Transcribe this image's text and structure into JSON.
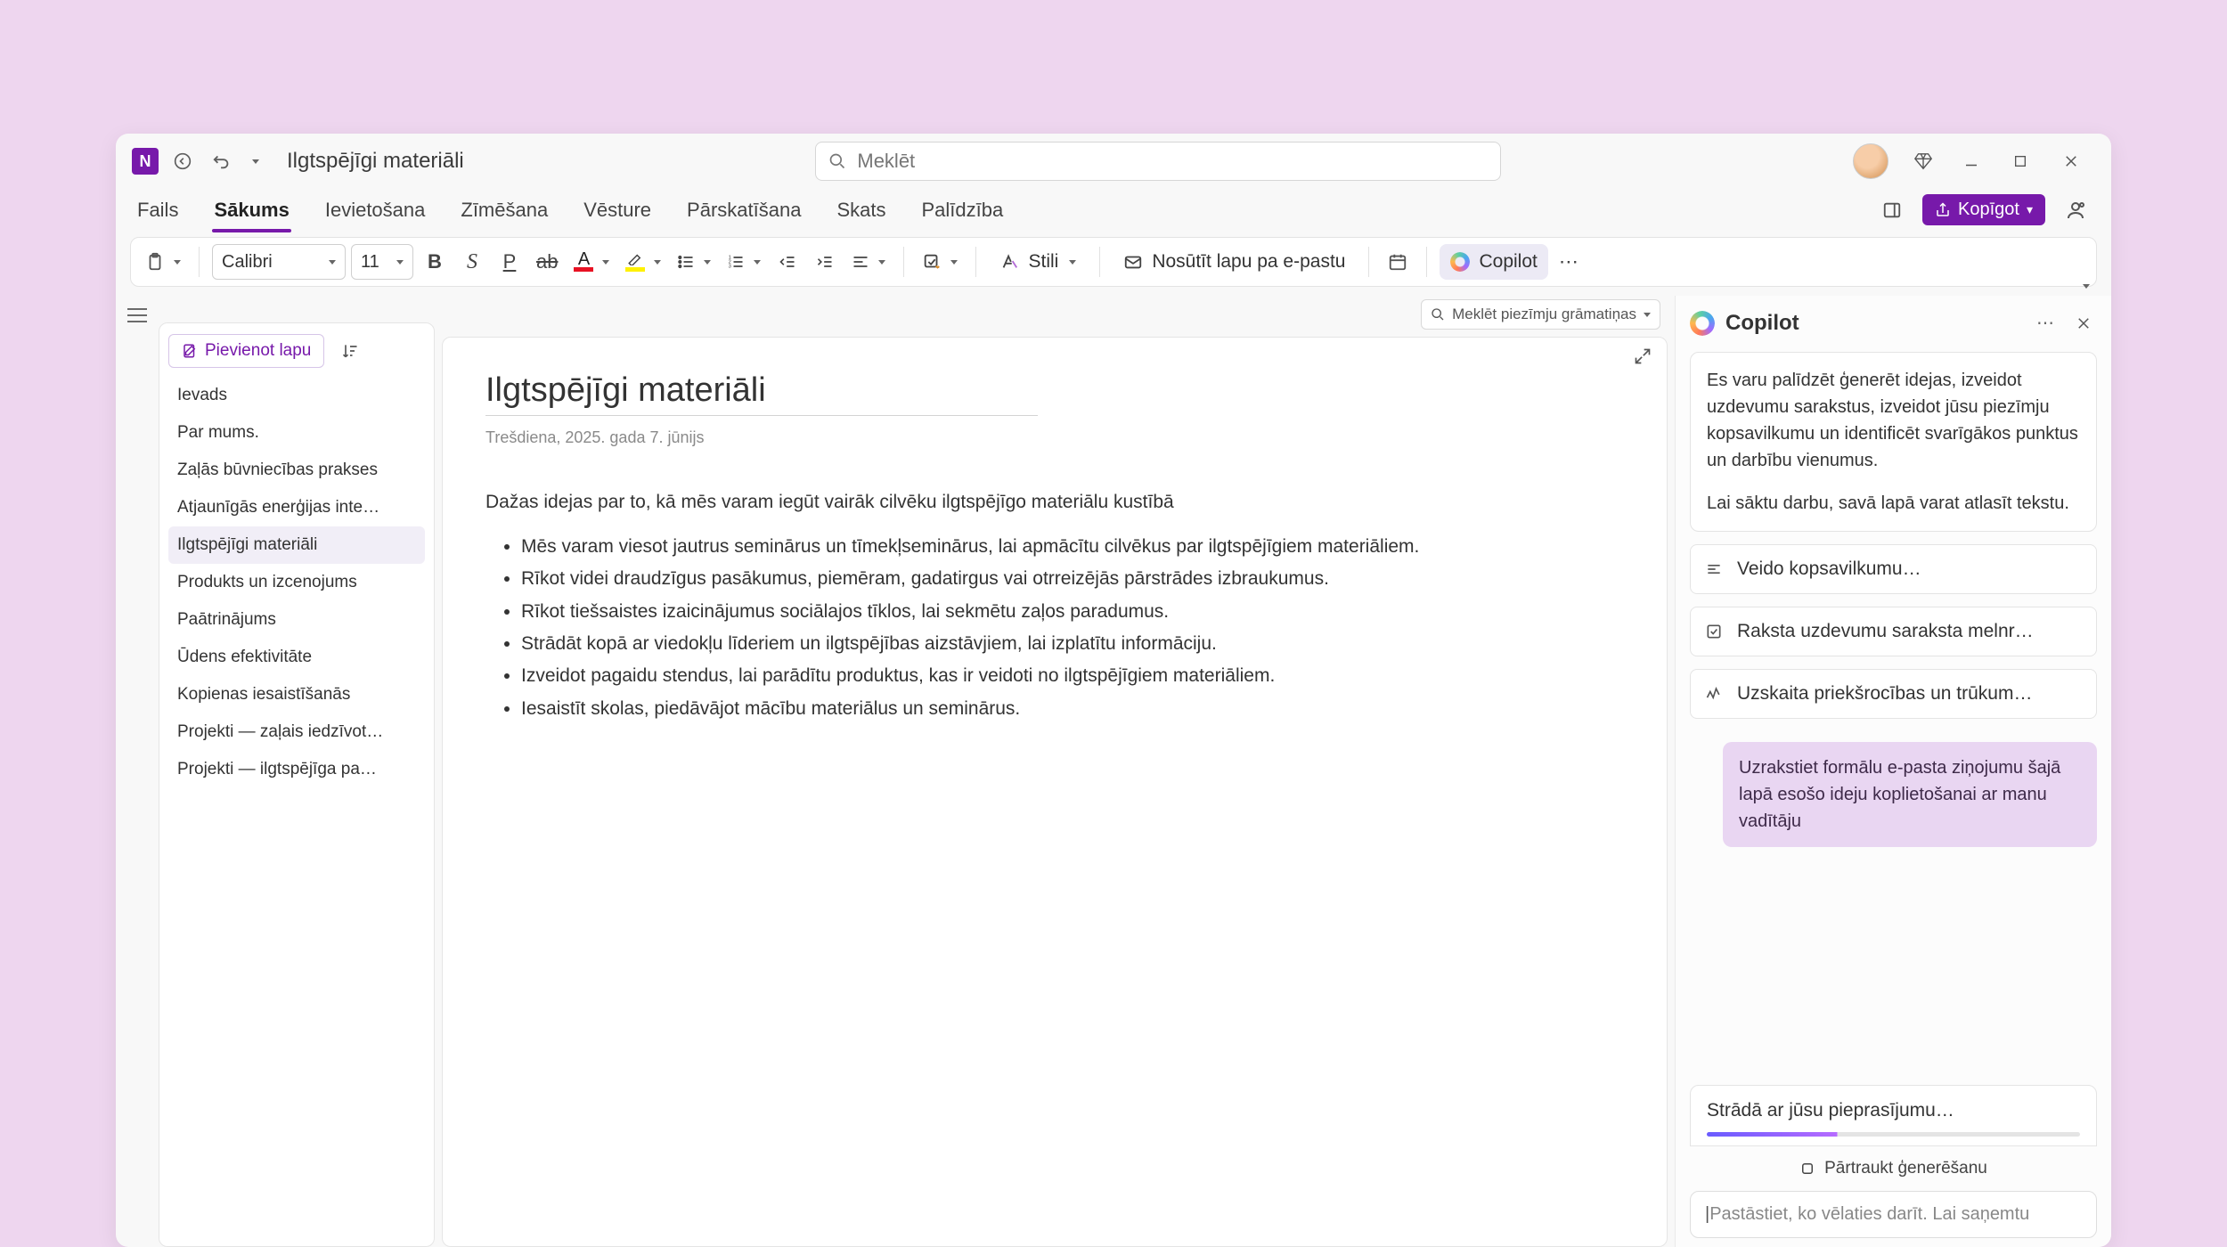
{
  "titlebar": {
    "doc_title": "Ilgtspējīgi materiāli",
    "search_placeholder": "Meklēt"
  },
  "tabs": [
    "Fails",
    "Sākums",
    "Ievietošana",
    "Zīmēšana",
    "Vēsture",
    "Pārskatīšana",
    "Skats",
    "Palīdzība"
  ],
  "active_tab_index": 1,
  "share_label": "Kopīgot",
  "ribbon": {
    "font_name": "Calibri",
    "font_size": "11",
    "styles_label": "Stili",
    "email_label": "Nosūtīt lapu pa e-pastu",
    "copilot_label": "Copilot"
  },
  "notebook_search_label": "Meklēt piezīmju grāmatiņas",
  "sidebar": {
    "add_page_label": "Pievienot lapu",
    "pages": [
      "Ievads",
      "Par mums.",
      "Zaļās būvniecības prakses",
      "Atjaunīgās enerģijas inte…",
      "Ilgtspējīgi materiāli",
      "Produkts un izcenojums",
      "Paātrinājums",
      "Ūdens efektivitāte",
      "Kopienas iesaistīšanās",
      "Projekti — zaļais iedzīvot…",
      "Projekti — ilgtspējīga pa…"
    ],
    "active_page_index": 4
  },
  "page": {
    "title": "Ilgtspējīgi materiāli",
    "date": "Trešdiena, 2025. gada 7. jūnijs",
    "intro": "Dažas idejas par to, kā mēs varam iegūt vairāk cilvēku ilgtspējīgo materiālu kustībā",
    "bullets": [
      "Mēs varam viesot jautrus seminārus un tīmekļseminārus, lai apmācītu cilvēkus par ilgtspējīgiem materiāliem.",
      "Rīkot videi draudzīgus pasākumus, piemēram, gadatirgus vai otrreizējās pārstrādes izbraukumus.",
      "Rīkot tiešsaistes izaicinājumus sociālajos tīklos, lai sekmētu zaļos paradumus.",
      "Strādāt kopā ar viedokļu līderiem un ilgtspējības aizstāvjiem, lai izplatītu informāciju.",
      "Izveidot pagaidu stendus, lai parādītu produktus, kas ir veidoti no ilgtspējīgiem materiāliem.",
      "Iesaistīt skolas, piedāvājot mācību materiālus un seminārus."
    ]
  },
  "copilot": {
    "title": "Copilot",
    "intro1": "Es varu palīdzēt ģenerēt idejas, izveidot uzdevumu sarakstus, izveidot jūsu piezīmju kopsavilkumu un identificēt svarīgākos punktus un darbību vienumus.",
    "intro2": "Lai sāktu darbu, savā lapā varat atlasīt tekstu.",
    "suggestions": [
      {
        "label": "Veido kopsavilkumu…"
      },
      {
        "label": "Raksta uzdevumu saraksta melnr…"
      },
      {
        "label": "Uzskaita priekšrocības un trūkum…"
      }
    ],
    "user_message": "Uzrakstiet formālu e-pasta ziņojumu šajā lapā esošo ideju koplietošanai ar manu vadītāju",
    "status": "Strādā ar jūsu pieprasījumu…",
    "stop": "Pārtraukt ģenerēšanu",
    "input_placeholder": "Pastāstiet, ko vēlaties darīt. Lai saņemtu"
  }
}
